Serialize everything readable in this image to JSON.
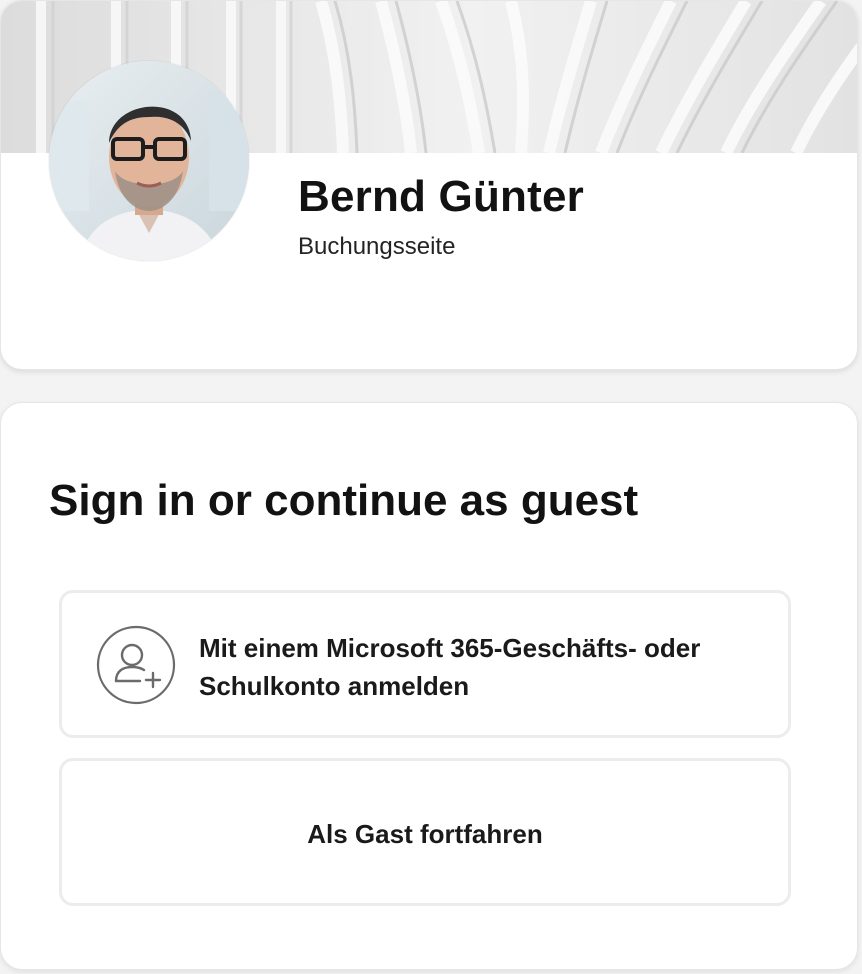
{
  "profile": {
    "name": "Bernd Günter",
    "subtitle": "Buchungsseite",
    "avatar_icon": "person-photo",
    "banner_icon": "abstract-curves"
  },
  "signin": {
    "title": "Sign in or continue as guest",
    "microsoft_option": {
      "label": "Mit einem Microsoft 365-Geschäfts- oder Schulkonto anmelden",
      "icon": "person-add-icon"
    },
    "guest_option": {
      "label": "Als Gast fortfahren"
    }
  },
  "colors": {
    "background": "#f3f3f3",
    "card": "#ffffff",
    "button_border": "#ececec",
    "text": "#1a1a1a"
  }
}
